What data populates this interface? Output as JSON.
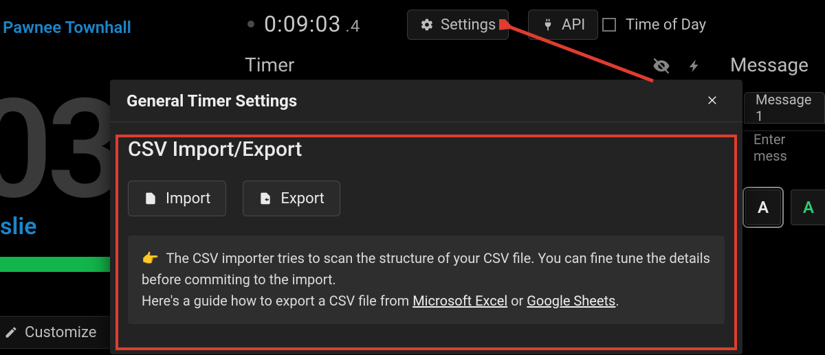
{
  "header": {
    "project_title": "Pawnee Townhall",
    "timecode_main": "0:09:03",
    "timecode_frac": ".4",
    "settings_label": "Settings",
    "api_label": "API",
    "time_of_day_label": "Time of Day"
  },
  "row2": {
    "timer_label": "Timer",
    "message_header": "Message"
  },
  "left": {
    "big_digits": "03",
    "speaker_name": "slie",
    "customize_label": "Customize"
  },
  "right": {
    "tab_label": "Message 1",
    "input_placeholder": "Enter mess",
    "color_a": "A",
    "color_b": "A"
  },
  "modal": {
    "title": "General Timer Settings",
    "section_title": "CSV Import/Export",
    "import_label": "Import",
    "export_label": "Export",
    "info_line1": "The CSV importer tries to scan the structure of your CSV file. You can fine tune the details before commiting to the import.",
    "info_line2a": "Here's a guide how to export a CSV file from ",
    "link_excel": "Microsoft Excel",
    "info_or": " or ",
    "link_sheets": "Google Sheets",
    "info_end": "."
  },
  "colors": {
    "accent_blue": "#1a86cc",
    "accent_green": "#12b54a",
    "annotation_red": "#e03c2f"
  }
}
